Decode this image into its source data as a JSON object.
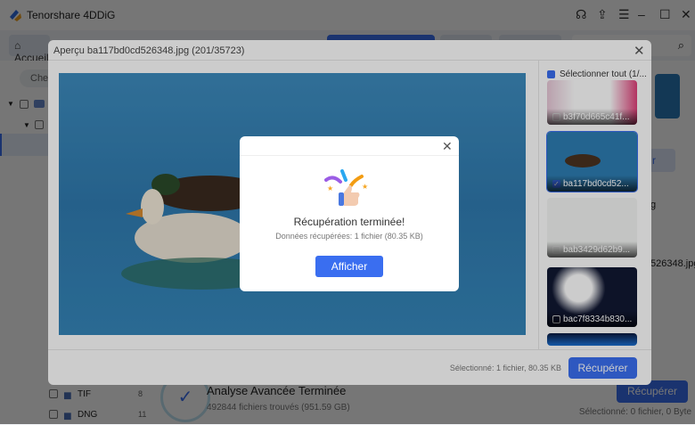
{
  "app": {
    "title": "Tenorshare 4DDiG",
    "home_label": "Accueil",
    "search_pill": "Chercher",
    "tree": [
      {
        "label": "TIF",
        "count": "8"
      },
      {
        "label": "DNG",
        "count": "11"
      }
    ],
    "status_title": "Analyse Avancée Terminée",
    "status_sub": "492844 fichiers trouvés (951.59 GB)",
    "recover_label": "Récupérer",
    "selected_text": "Sélectionné: 0 fichier, 0 Byte",
    "peek_filename": "526348.jpg",
    "peek_g": "g",
    "peek_r": "r"
  },
  "preview": {
    "title": "Aperçu  ba117bd0cd526348.jpg (201/35723)",
    "select_all": "Sélectionner tout (1/...",
    "thumbs": [
      {
        "name": "b3f70d665c41f...",
        "checked": false
      },
      {
        "name": "ba117bd0cd52...",
        "checked": true
      },
      {
        "name": "bab3429d62b9...",
        "checked": false
      },
      {
        "name": "bac7f8334b830...",
        "checked": false
      }
    ],
    "selected_text": "Sélectionné: 1 fichier, 80.35 KB",
    "recover_label": "Récupérer"
  },
  "dialog": {
    "title": "Récupération terminée!",
    "subtitle": "Données récupérées: 1 fichier (80.35 KB)",
    "button": "Afficher",
    "close": "✕"
  },
  "colors": {
    "accent": "#3a6ef0"
  }
}
